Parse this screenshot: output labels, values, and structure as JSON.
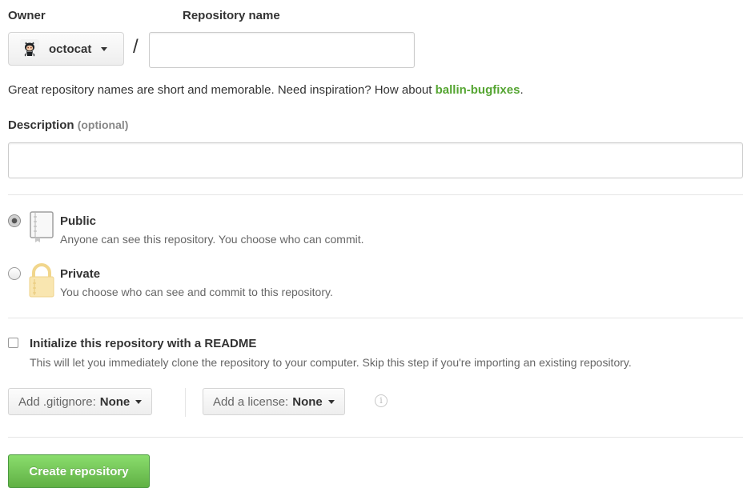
{
  "owner": {
    "label": "Owner",
    "selected": "octocat",
    "avatar_icon": "octocat-avatar-icon"
  },
  "repository": {
    "label": "Repository name",
    "separator": "/",
    "value": "",
    "hint_prefix": "Great repository names are short and memorable. Need inspiration? How about ",
    "hint_suggestion": "ballin-bugfixes",
    "hint_suffix": "."
  },
  "description": {
    "label": "Description",
    "optional": "(optional)",
    "value": ""
  },
  "visibility": {
    "selected": "public",
    "options": [
      {
        "id": "public",
        "title": "Public",
        "desc": "Anyone can see this repository. You choose who can commit.",
        "icon": "repo-book-icon"
      },
      {
        "id": "private",
        "title": "Private",
        "desc": "You choose who can see and commit to this repository.",
        "icon": "lock-icon"
      }
    ]
  },
  "readme": {
    "checked": false,
    "label": "Initialize this repository with a README",
    "desc": "This will let you immediately clone the repository to your computer. Skip this step if you're importing an existing repository."
  },
  "gitignore": {
    "prefix": "Add .gitignore:",
    "value": "None"
  },
  "license": {
    "prefix": "Add a license:",
    "value": "None"
  },
  "info_icon": "info-icon",
  "submit": {
    "label": "Create repository"
  },
  "colors": {
    "accent_green": "#55a532",
    "button_green_top": "#8add6d",
    "button_green_bottom": "#60b044",
    "lock_yellow": "#f5dfa0"
  }
}
